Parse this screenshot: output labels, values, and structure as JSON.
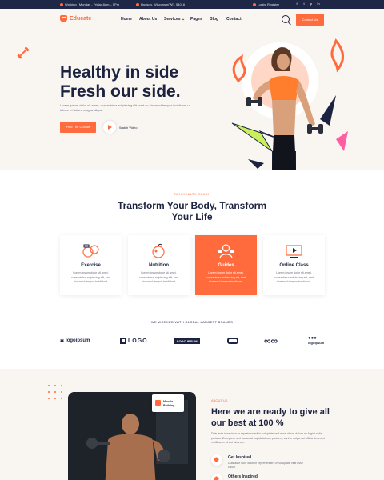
{
  "topbar": {
    "hours": "Working : Monday - Friday,8am – 5Pm",
    "address": "Hudson, Wisconsin(WI), 54016",
    "auth": "Login/ Register",
    "social": [
      "f",
      "t",
      "p",
      "in"
    ]
  },
  "nav": {
    "brand": "Educate",
    "items": [
      "Home",
      "About Us",
      "Services",
      "Pages",
      "Blog",
      "Contact"
    ],
    "cta": "Contact Us"
  },
  "hero": {
    "title_line1": "Healthy in side",
    "title_line2": "Fresh our side.",
    "desc": "Lorem ipsum dolor sit amet, consectetur adipiscing elit, sed do eiusmod tempor incididunt ut labore et dolore magna aliqua.",
    "primary_btn": "Find The Course",
    "video_label": "Watch Video"
  },
  "services": {
    "eyebrow": "BWH HEALTH COACH",
    "title": "Transform Your Body, Transform Your Life",
    "cards": [
      {
        "title": "Exercise",
        "desc": "Lorem ipsum dolor sit amet, consectetur adipiscing elit, sed eiusmod tempor incididunt."
      },
      {
        "title": "Nutrition",
        "desc": "Lorem ipsum dolor sit amet, consectetur adipiscing elit, sed eiusmod tempor incididunt."
      },
      {
        "title": "Guides",
        "desc": "Lorem ipsum dolor sit amet, consectetur adipiscing elit, sed eiusmod tempor incididunt."
      },
      {
        "title": "Online Class",
        "desc": "Lorem ipsum dolor sit amet, consectetur adipiscing elit, sed eiusmod tempor incididunt."
      }
    ]
  },
  "brands": {
    "label": "WE WORKED WITH GLOBAL LARGEST BRANDS",
    "items": [
      "logoipsum",
      "LOGO",
      "LOGO IPSUM",
      "",
      "",
      "logoipsum"
    ]
  },
  "about": {
    "badge": "Muscle Building",
    "eyebrow": "ABOUT US",
    "title": "Here we are ready to give all our best at 100 %",
    "desc": "Duis aute irure dolor in reprehenderit in voluptate velit esse cillum dolore eu fugiat nulla pariatur. Excepteur sint occaecat cupidatat non proident, sunt in culpa qui officia deserunt mollit anim id est laborum.",
    "features": [
      {
        "title": "Get Inspired",
        "desc": "Duis aute irure dolor in reprehenderit in voluptate velit esse cillum"
      },
      {
        "title": "Others Inspired",
        "desc": ""
      }
    ]
  },
  "colors": {
    "accent": "#ff6b3d",
    "navy": "#1f2747",
    "cream": "#f9f5f1"
  }
}
